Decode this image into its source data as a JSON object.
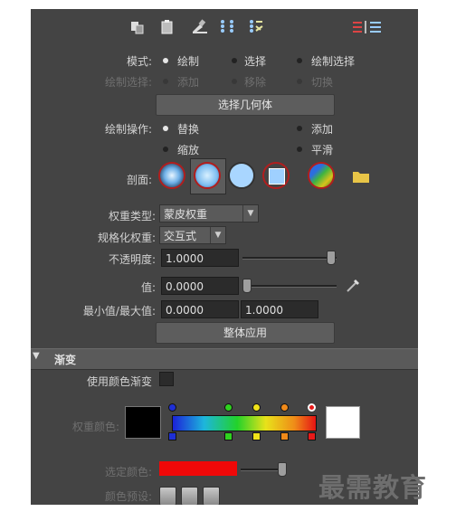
{
  "mode": {
    "label": "模式:",
    "options": [
      "绘制",
      "选择",
      "绘制选择"
    ],
    "selected": "绘制"
  },
  "paint_select": {
    "label": "绘制选择:",
    "options": [
      "添加",
      "移除",
      "切换"
    ]
  },
  "select_geometry_button": "选择几何体",
  "paint_operation": {
    "label": "绘制操作:",
    "options": [
      "替换",
      "添加",
      "缩放",
      "平滑"
    ],
    "selected": "替换"
  },
  "profile": {
    "label": "剖面:",
    "icons": [
      "gaussian-brush-icon",
      "soft-brush-icon",
      "solid-round-brush-icon",
      "square-brush-icon",
      "image-brush-icon",
      "folder-icon"
    ]
  },
  "weight_type": {
    "label": "权重类型:",
    "value": "蒙皮权重"
  },
  "normalize_weights": {
    "label": "规格化权重:",
    "value": "交互式"
  },
  "opacity": {
    "label": "不透明度:",
    "value": "1.0000",
    "slider_level": 1.0
  },
  "value": {
    "label": "值:",
    "value": "0.0000",
    "slider_level": 0.0
  },
  "min_max": {
    "label": "最小值/最大值:",
    "min": "0.0000",
    "max": "1.0000"
  },
  "flood_button": "整体应用",
  "gradient_section": {
    "title": "渐变",
    "use_color_ramp_label": "使用颜色渐变",
    "weight_color_label": "权重颜色:",
    "selected_color_label": "选定颜色:",
    "color_presets_label": "颜色预设:",
    "ramp_top_markers": [
      "#1e2fd6",
      "#2fd21f",
      "#f0e21a",
      "#f08a1a",
      "#e81a1a"
    ],
    "selected_color": "#f00808",
    "black_swatch": "#000000",
    "white_swatch": "#ffffff"
  },
  "watermark": "最需教育"
}
